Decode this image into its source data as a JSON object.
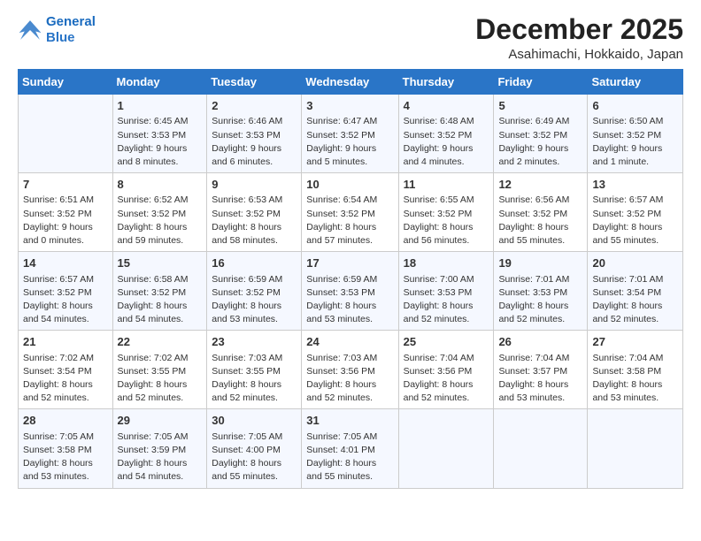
{
  "logo": {
    "line1": "General",
    "line2": "Blue"
  },
  "header": {
    "month": "December 2025",
    "location": "Asahimachi, Hokkaido, Japan"
  },
  "weekdays": [
    "Sunday",
    "Monday",
    "Tuesday",
    "Wednesday",
    "Thursday",
    "Friday",
    "Saturday"
  ],
  "weeks": [
    [
      {
        "day": "",
        "info": ""
      },
      {
        "day": "1",
        "info": "Sunrise: 6:45 AM\nSunset: 3:53 PM\nDaylight: 9 hours\nand 8 minutes."
      },
      {
        "day": "2",
        "info": "Sunrise: 6:46 AM\nSunset: 3:53 PM\nDaylight: 9 hours\nand 6 minutes."
      },
      {
        "day": "3",
        "info": "Sunrise: 6:47 AM\nSunset: 3:52 PM\nDaylight: 9 hours\nand 5 minutes."
      },
      {
        "day": "4",
        "info": "Sunrise: 6:48 AM\nSunset: 3:52 PM\nDaylight: 9 hours\nand 4 minutes."
      },
      {
        "day": "5",
        "info": "Sunrise: 6:49 AM\nSunset: 3:52 PM\nDaylight: 9 hours\nand 2 minutes."
      },
      {
        "day": "6",
        "info": "Sunrise: 6:50 AM\nSunset: 3:52 PM\nDaylight: 9 hours\nand 1 minute."
      }
    ],
    [
      {
        "day": "7",
        "info": "Sunrise: 6:51 AM\nSunset: 3:52 PM\nDaylight: 9 hours\nand 0 minutes."
      },
      {
        "day": "8",
        "info": "Sunrise: 6:52 AM\nSunset: 3:52 PM\nDaylight: 8 hours\nand 59 minutes."
      },
      {
        "day": "9",
        "info": "Sunrise: 6:53 AM\nSunset: 3:52 PM\nDaylight: 8 hours\nand 58 minutes."
      },
      {
        "day": "10",
        "info": "Sunrise: 6:54 AM\nSunset: 3:52 PM\nDaylight: 8 hours\nand 57 minutes."
      },
      {
        "day": "11",
        "info": "Sunrise: 6:55 AM\nSunset: 3:52 PM\nDaylight: 8 hours\nand 56 minutes."
      },
      {
        "day": "12",
        "info": "Sunrise: 6:56 AM\nSunset: 3:52 PM\nDaylight: 8 hours\nand 55 minutes."
      },
      {
        "day": "13",
        "info": "Sunrise: 6:57 AM\nSunset: 3:52 PM\nDaylight: 8 hours\nand 55 minutes."
      }
    ],
    [
      {
        "day": "14",
        "info": "Sunrise: 6:57 AM\nSunset: 3:52 PM\nDaylight: 8 hours\nand 54 minutes."
      },
      {
        "day": "15",
        "info": "Sunrise: 6:58 AM\nSunset: 3:52 PM\nDaylight: 8 hours\nand 54 minutes."
      },
      {
        "day": "16",
        "info": "Sunrise: 6:59 AM\nSunset: 3:52 PM\nDaylight: 8 hours\nand 53 minutes."
      },
      {
        "day": "17",
        "info": "Sunrise: 6:59 AM\nSunset: 3:53 PM\nDaylight: 8 hours\nand 53 minutes."
      },
      {
        "day": "18",
        "info": "Sunrise: 7:00 AM\nSunset: 3:53 PM\nDaylight: 8 hours\nand 52 minutes."
      },
      {
        "day": "19",
        "info": "Sunrise: 7:01 AM\nSunset: 3:53 PM\nDaylight: 8 hours\nand 52 minutes."
      },
      {
        "day": "20",
        "info": "Sunrise: 7:01 AM\nSunset: 3:54 PM\nDaylight: 8 hours\nand 52 minutes."
      }
    ],
    [
      {
        "day": "21",
        "info": "Sunrise: 7:02 AM\nSunset: 3:54 PM\nDaylight: 8 hours\nand 52 minutes."
      },
      {
        "day": "22",
        "info": "Sunrise: 7:02 AM\nSunset: 3:55 PM\nDaylight: 8 hours\nand 52 minutes."
      },
      {
        "day": "23",
        "info": "Sunrise: 7:03 AM\nSunset: 3:55 PM\nDaylight: 8 hours\nand 52 minutes."
      },
      {
        "day": "24",
        "info": "Sunrise: 7:03 AM\nSunset: 3:56 PM\nDaylight: 8 hours\nand 52 minutes."
      },
      {
        "day": "25",
        "info": "Sunrise: 7:04 AM\nSunset: 3:56 PM\nDaylight: 8 hours\nand 52 minutes."
      },
      {
        "day": "26",
        "info": "Sunrise: 7:04 AM\nSunset: 3:57 PM\nDaylight: 8 hours\nand 53 minutes."
      },
      {
        "day": "27",
        "info": "Sunrise: 7:04 AM\nSunset: 3:58 PM\nDaylight: 8 hours\nand 53 minutes."
      }
    ],
    [
      {
        "day": "28",
        "info": "Sunrise: 7:05 AM\nSunset: 3:58 PM\nDaylight: 8 hours\nand 53 minutes."
      },
      {
        "day": "29",
        "info": "Sunrise: 7:05 AM\nSunset: 3:59 PM\nDaylight: 8 hours\nand 54 minutes."
      },
      {
        "day": "30",
        "info": "Sunrise: 7:05 AM\nSunset: 4:00 PM\nDaylight: 8 hours\nand 55 minutes."
      },
      {
        "day": "31",
        "info": "Sunrise: 7:05 AM\nSunset: 4:01 PM\nDaylight: 8 hours\nand 55 minutes."
      },
      {
        "day": "",
        "info": ""
      },
      {
        "day": "",
        "info": ""
      },
      {
        "day": "",
        "info": ""
      }
    ]
  ]
}
